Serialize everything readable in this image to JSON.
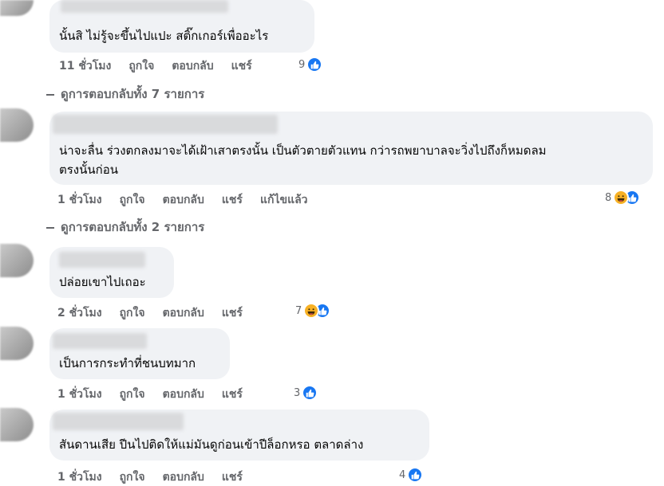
{
  "comments": [
    {
      "text_lines": [
        "นั้นสิ ไม่รู้จะขึ้นไปแปะ สติ๊กเกอร์เพื่ออะไร"
      ],
      "time": "11 ชั่วโมง",
      "like": "ถูกใจ",
      "reply": "ตอบกลับ",
      "share": "แชร์",
      "edited": "",
      "reaction_count": "9",
      "reactions": [
        "like"
      ]
    },
    {
      "text_lines": [
        "น่าจะลื่น ร่วงตกลงมาจะได้เฝ้าเสาตรงนั้น เป็นตัวตายตัวแทน กว่ารถพยาบาลจะวิ่งไปถึงก็หมดลม",
        "ตรงนั้นก่อน"
      ],
      "time": "1 ชั่วโมง",
      "like": "ถูกใจ",
      "reply": "ตอบกลับ",
      "share": "แชร์",
      "edited": "แก้ไขแล้ว",
      "reaction_count": "8",
      "reactions": [
        "haha",
        "like"
      ]
    },
    {
      "text_lines": [
        "ปล่อยเขาไปเถอะ"
      ],
      "time": "2 ชั่วโมง",
      "like": "ถูกใจ",
      "reply": "ตอบกลับ",
      "share": "แชร์",
      "edited": "",
      "reaction_count": "7",
      "reactions": [
        "haha",
        "like"
      ]
    },
    {
      "text_lines": [
        "เป็นการกระทำที่ชนบทมาก"
      ],
      "time": "1 ชั่วโมง",
      "like": "ถูกใจ",
      "reply": "ตอบกลับ",
      "share": "แชร์",
      "edited": "",
      "reaction_count": "3",
      "reactions": [
        "like"
      ]
    },
    {
      "text_lines": [
        "สันดานเสีย ปีนไปติดให้แม่มันดูก่อนเข้าปีล็อกหรอ ตลาดล่าง"
      ],
      "time": "1 ชั่วโมง",
      "like": "ถูกใจ",
      "reply": "ตอบกลับ",
      "share": "แชร์",
      "edited": "",
      "reaction_count": "4",
      "reactions": [
        "like"
      ]
    }
  ],
  "view_replies": [
    "ดูการตอบกลับทั้ง 7 รายการ",
    "ดูการตอบกลับทั้ง 2 รายการ"
  ],
  "colors": {
    "bubble": "#f0f2f5",
    "meta_text": "#65676b",
    "like_blue": "#1877f2",
    "haha_yellow": "#f7b125"
  }
}
